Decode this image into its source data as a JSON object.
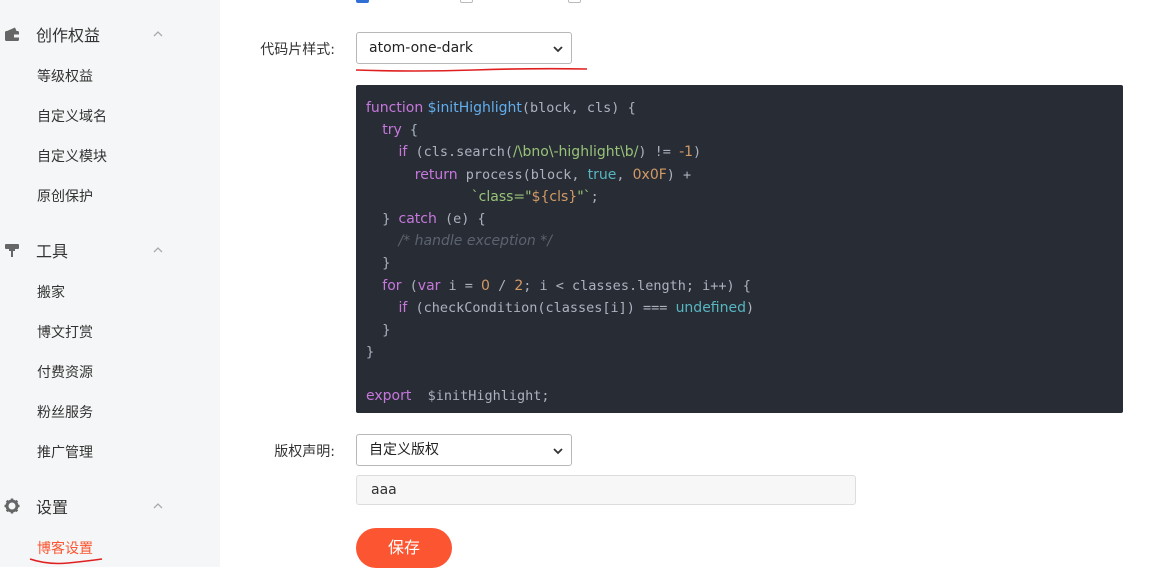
{
  "sidebar": {
    "groups": [
      {
        "title": "创作权益",
        "icon": "wallet-icon",
        "items": [
          "等级权益",
          "自定义域名",
          "自定义模块",
          "原创保护"
        ]
      },
      {
        "title": "工具",
        "icon": "tools-icon",
        "items": [
          "搬家",
          "博文打赏",
          "付费资源",
          "粉丝服务",
          "推广管理"
        ]
      },
      {
        "title": "设置",
        "icon": "gear-icon",
        "items": [
          "博客设置"
        ]
      }
    ],
    "active_item": "博客设置",
    "active_color": "#fc5531",
    "annotation_underline_color": "#e02020"
  },
  "form": {
    "code_style": {
      "label": "代码片样式:",
      "selected": "atom-one-dark"
    },
    "code_preview": {
      "background": "#282c34",
      "lines": [
        [
          [
            "kw",
            "function "
          ],
          [
            "fn",
            "$initHighlight"
          ],
          [
            "plain",
            "(block, cls) {"
          ]
        ],
        [
          [
            "plain",
            "  "
          ],
          [
            "kw",
            "try"
          ],
          [
            "plain",
            " {"
          ]
        ],
        [
          [
            "plain",
            "    "
          ],
          [
            "kw",
            "if"
          ],
          [
            "plain",
            " (cls.search("
          ],
          [
            "str",
            "/\\bno\\-highlight\\b/"
          ],
          [
            "plain",
            ") != "
          ],
          [
            "num",
            "-1"
          ],
          [
            "plain",
            ")"
          ]
        ],
        [
          [
            "plain",
            "      "
          ],
          [
            "kw",
            "return"
          ],
          [
            "plain",
            " process(block, "
          ],
          [
            "bi",
            "true"
          ],
          [
            "plain",
            ", "
          ],
          [
            "num",
            "0x0F"
          ],
          [
            "plain",
            ") +"
          ]
        ],
        [
          [
            "plain",
            "             "
          ],
          [
            "str",
            "`class=\""
          ],
          [
            "num",
            "${cls}"
          ],
          [
            "str",
            "\"`"
          ],
          [
            "plain",
            ";"
          ]
        ],
        [
          [
            "plain",
            "  } "
          ],
          [
            "kw",
            "catch"
          ],
          [
            "plain",
            " (e) {"
          ]
        ],
        [
          [
            "plain",
            "    "
          ],
          [
            "cmt",
            "/* handle exception */"
          ]
        ],
        [
          [
            "plain",
            "  }"
          ]
        ],
        [
          [
            "plain",
            "  "
          ],
          [
            "kw",
            "for"
          ],
          [
            "plain",
            " ("
          ],
          [
            "kw",
            "var"
          ],
          [
            "plain",
            " i = "
          ],
          [
            "num",
            "0"
          ],
          [
            "plain",
            " / "
          ],
          [
            "num",
            "2"
          ],
          [
            "plain",
            "; i < classes.length; i++) {"
          ]
        ],
        [
          [
            "plain",
            "    "
          ],
          [
            "kw",
            "if"
          ],
          [
            "plain",
            " (checkCondition(classes[i]) === "
          ],
          [
            "bi",
            "undefined"
          ],
          [
            "plain",
            ")"
          ]
        ],
        [
          [
            "plain",
            "  }"
          ]
        ],
        [
          [
            "plain",
            "}"
          ]
        ],
        [
          [
            "plain",
            ""
          ]
        ],
        [
          [
            "kw",
            "export"
          ],
          [
            "plain",
            "  $initHighlight;"
          ]
        ]
      ]
    },
    "copyright": {
      "label": "版权声明:",
      "selected": "自定义版权",
      "custom_text": "aaa"
    },
    "save_label": "保存",
    "save_color": "#fc5531"
  }
}
